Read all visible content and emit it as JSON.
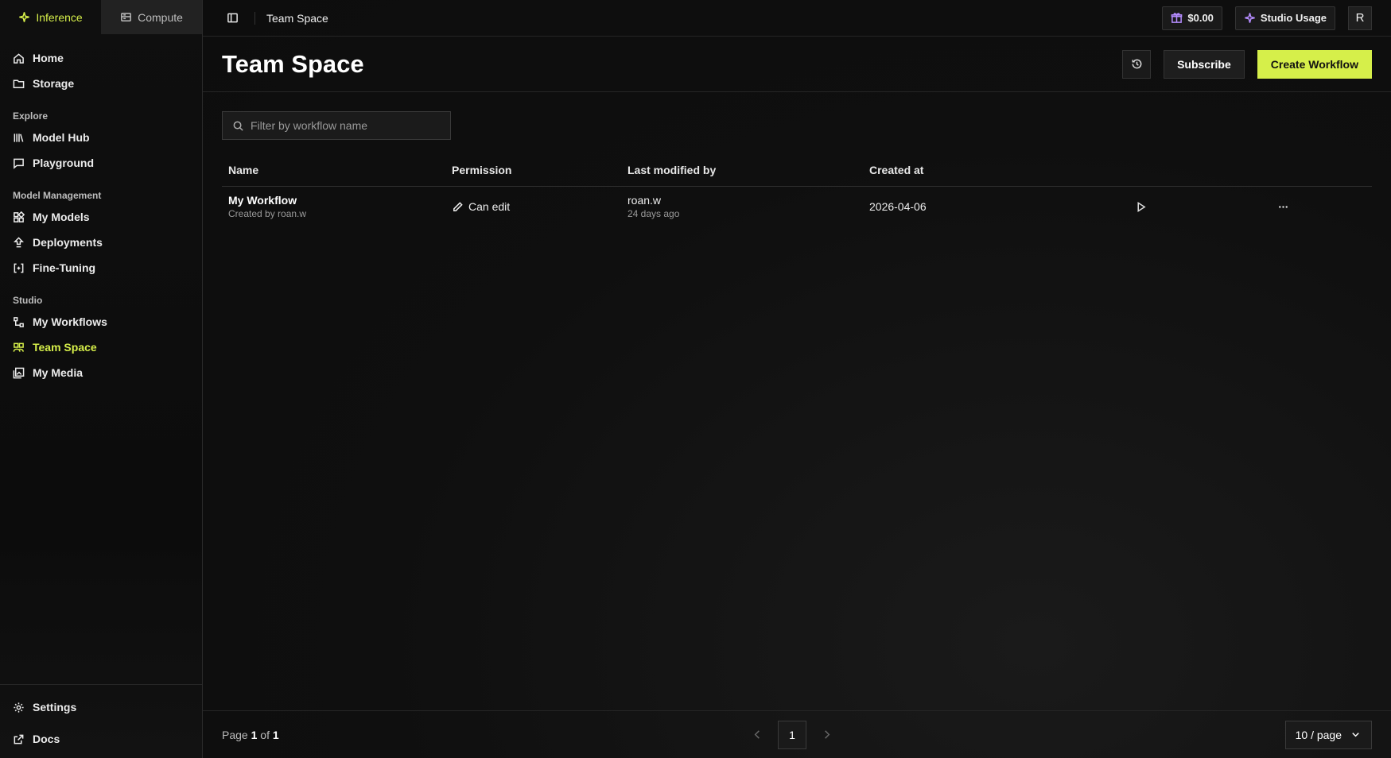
{
  "sidebar": {
    "tabs": [
      {
        "label": "Inference",
        "icon": "sparkle-icon"
      },
      {
        "label": "Compute",
        "icon": "server-icon"
      }
    ],
    "nav_top": [
      {
        "label": "Home",
        "icon": "home-icon"
      },
      {
        "label": "Storage",
        "icon": "folder-icon"
      }
    ],
    "explore": {
      "title": "Explore",
      "items": [
        {
          "label": "Model Hub",
          "icon": "library-icon"
        },
        {
          "label": "Playground",
          "icon": "chat-icon"
        }
      ]
    },
    "model_management": {
      "title": "Model Management",
      "items": [
        {
          "label": "My Models",
          "icon": "models-icon"
        },
        {
          "label": "Deployments",
          "icon": "deploy-icon"
        },
        {
          "label": "Fine-Tuning",
          "icon": "tune-icon"
        }
      ]
    },
    "studio": {
      "title": "Studio",
      "items": [
        {
          "label": "My Workflows",
          "icon": "workflow-icon"
        },
        {
          "label": "Team Space",
          "icon": "team-icon"
        },
        {
          "label": "My Media",
          "icon": "media-icon"
        }
      ]
    },
    "bottom": [
      {
        "label": "Settings",
        "icon": "gear-icon"
      },
      {
        "label": "Docs",
        "icon": "external-link-icon"
      }
    ]
  },
  "topbar": {
    "crumb": "Team Space",
    "balance": "$0.00",
    "studio_usage": "Studio Usage",
    "avatar": "R"
  },
  "header": {
    "title": "Team Space",
    "subscribe": "Subscribe",
    "create": "Create Workflow"
  },
  "search": {
    "placeholder": "Filter by workflow name"
  },
  "table": {
    "columns": [
      "Name",
      "Permission",
      "Last modified by",
      "Created at"
    ],
    "rows": [
      {
        "name": "My Workflow",
        "created_by": "Created by roan.w",
        "permission": "Can edit",
        "modified_by": "roan.w",
        "modified_ago": "24 days ago",
        "created_at": "2026-04-06"
      }
    ]
  },
  "footer": {
    "page_prefix": "Page",
    "page_current": "1",
    "page_of": "of",
    "page_total": "1",
    "page_button": "1",
    "per_page": "10 / page"
  },
  "colors": {
    "accent": "#d6ef4a",
    "background": "#0e0e0e"
  }
}
